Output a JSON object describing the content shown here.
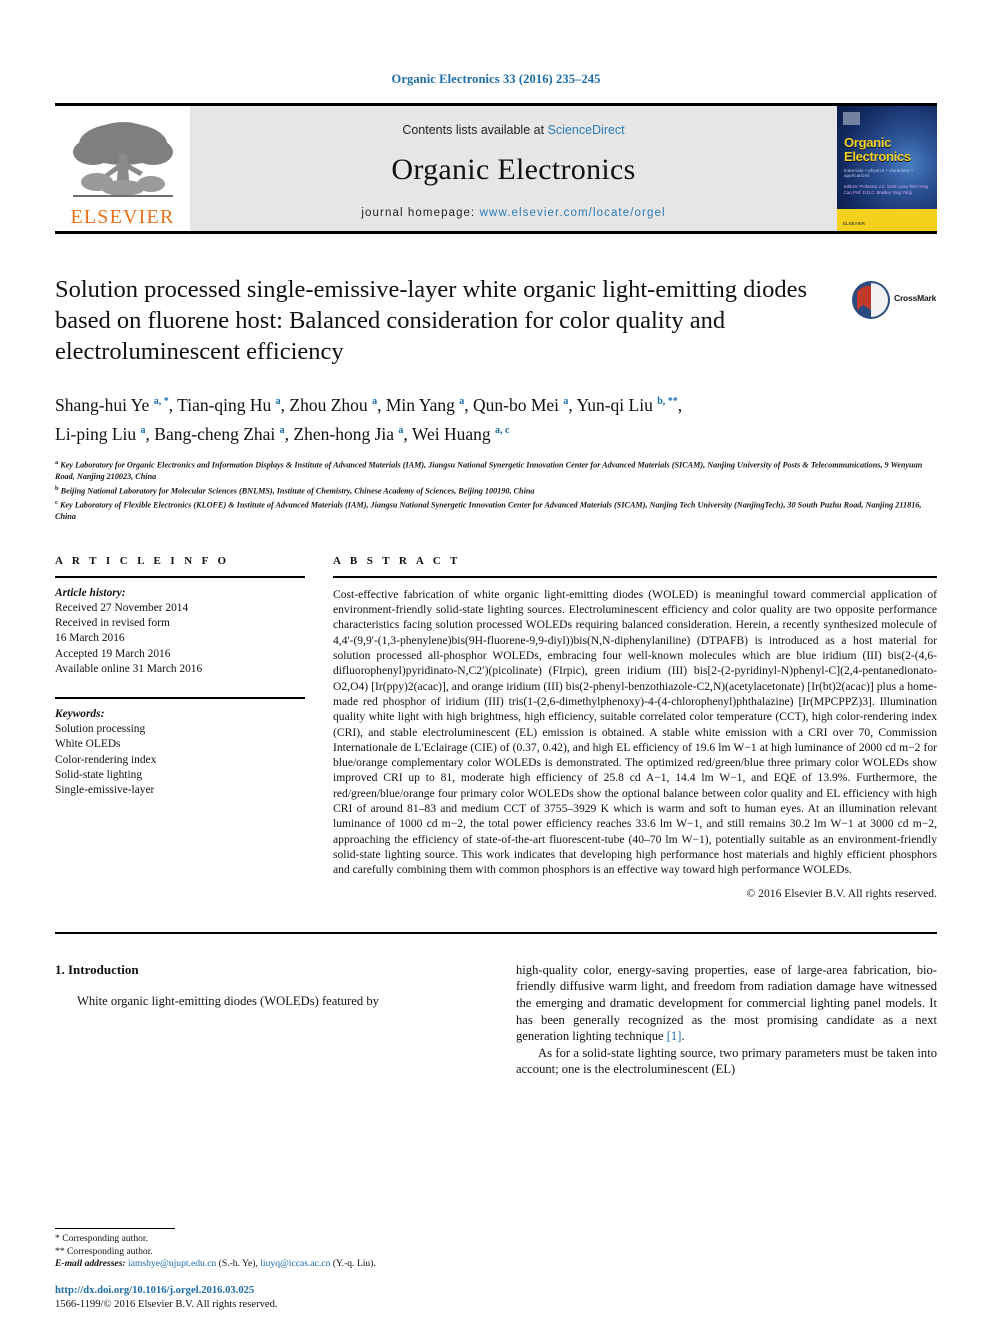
{
  "running_head": "Organic Electronics 33 (2016) 235–245",
  "masthead": {
    "publisher_name": "ELSEVIER",
    "contents_prefix": "Contents lists available at",
    "contents_link": "ScienceDirect",
    "journal_name": "Organic Electronics",
    "homepage_prefix": "journal homepage:",
    "homepage_url": "www.elsevier.com/locate/orgel",
    "cover": {
      "title_line1": "Organic",
      "title_line2": "Electronics",
      "subtitle": "materials • physics • chemistry • applications",
      "editors": "Editors:\nProfessor J.C. Scott\nLuisa Torsi\nYong Cao\nProf. D.D.C. Bradley\nYang Yang"
    }
  },
  "article": {
    "title": "Solution processed single-emissive-layer white organic light-emitting diodes based on fluorene host: Balanced consideration for color quality and electroluminescent efficiency",
    "crossmark_label": "CrossMark",
    "authors_line1": "Shang-hui Ye a, *, Tian-qing Hu a, Zhou Zhou a, Min Yang a, Qun-bo Mei a, Yun-qi Liu b, **,",
    "authors_line2": "Li-ping Liu a, Bang-cheng Zhai a, Zhen-hong Jia a, Wei Huang a, c",
    "authors": [
      {
        "name": "Shang-hui Ye",
        "marks": "a, *"
      },
      {
        "name": "Tian-qing Hu",
        "marks": "a"
      },
      {
        "name": "Zhou Zhou",
        "marks": "a"
      },
      {
        "name": "Min Yang",
        "marks": "a"
      },
      {
        "name": "Qun-bo Mei",
        "marks": "a"
      },
      {
        "name": "Yun-qi Liu",
        "marks": "b, **"
      },
      {
        "name": "Li-ping Liu",
        "marks": "a"
      },
      {
        "name": "Bang-cheng Zhai",
        "marks": "a"
      },
      {
        "name": "Zhen-hong Jia",
        "marks": "a"
      },
      {
        "name": "Wei Huang",
        "marks": "a, c"
      }
    ],
    "affiliations": [
      {
        "mark": "a",
        "text": "Key Laboratory for Organic Electronics and Information Displays & Institute of Advanced Materials (IAM), Jiangsu National Synergetic Innovation Center for Advanced Materials (SICAM), Nanjing University of Posts & Telecommunications, 9 Wenyuan Road, Nanjing 210023, China"
      },
      {
        "mark": "b",
        "text": "Beijing National Laboratory for Molecular Sciences (BNLMS), Institute of Chemistry, Chinese Academy of Sciences, Beijing 100190, China"
      },
      {
        "mark": "c",
        "text": "Key Laboratory of Flexible Electronics (KLOFE) & Institute of Advanced Materials (IAM), Jiangsu National Synergetic Innovation Center for Advanced Materials (SICAM), Nanjing Tech University (NanjingTech), 30 South Puzhu Road, Nanjing 211816, China"
      }
    ]
  },
  "article_info": {
    "heading": "A R T I C L E   I N F O",
    "history_label": "Article history:",
    "history": [
      "Received 27 November 2014",
      "Received in revised form",
      "16 March 2016",
      "Accepted 19 March 2016",
      "Available online 31 March 2016"
    ],
    "keywords_label": "Keywords:",
    "keywords": [
      "Solution processing",
      "White OLEDs",
      "Color-rendering index",
      "Solid-state lighting",
      "Single-emissive-layer"
    ]
  },
  "abstract": {
    "heading": "A B S T R A C T",
    "text": "Cost-effective fabrication of white organic light-emitting diodes (WOLED) is meaningful toward commercial application of environment-friendly solid-state lighting sources. Electroluminescent efficiency and color quality are two opposite performance characteristics facing solution processed WOLEDs requiring balanced consideration. Herein, a recently synthesized molecule of 4,4'-(9,9'-(1,3-phenylene)bis(9H-fluorene-9,9-diyl))bis(N,N-diphenylaniline) (DTPAFB) is introduced as a host material for solution processed all-phosphor WOLEDs, embracing four well-known molecules which are blue iridium (III) bis(2-(4,6-difluorophenyl)pyridinato-N,C2′)(picolinate) (FIrpic), green iridium (III) bis[2-(2-pyridinyl-N)phenyl-C](2,4-pentanedionato-O2,O4) [Ir(ppy)2(acac)], and orange iridium (III) bis(2-phenyl-benzothiazole-C2,N)(acetylacetonate) [Ir(bt)2(acac)] plus a home-made red phosphor of iridium (III) tris(1-(2,6-dimethylphenoxy)-4-(4-chlorophenyl)phthalazine) [Ir(MPCPPZ)3]. Illumination quality white light with high brightness, high efficiency, suitable correlated color temperature (CCT), high color-rendering index (CRI), and stable electroluminescent (EL) emission is obtained. A stable white emission with a CRI over 70, Commission Internationale de L'Eclairage (CIE) of (0.37, 0.42), and high EL efficiency of 19.6 lm W−1 at high luminance of 2000 cd m−2 for blue/orange complementary color WOLEDs is demonstrated. The optimized red/green/blue three primary color WOLEDs show improved CRI up to 81, moderate high efficiency of 25.8 cd A−1, 14.4 lm W−1, and EQE of 13.9%. Furthermore, the red/green/blue/orange four primary color WOLEDs show the optional balance between color quality and EL efficiency with high CRI of around 81–83 and medium CCT of 3755–3929 K which is warm and soft to human eyes. At an illumination relevant luminance of 1000 cd m−2, the total power efficiency reaches 33.6 lm W−1, and still remains 30.2 lm W−1 at 3000 cd m−2, approaching the efficiency of state-of-the-art fluorescent-tube (40–70 lm W−1), potentially suitable as an environment-friendly solid-state lighting source. This work indicates that developing high performance host materials and highly efficient phosphors and carefully combining them with common phosphors is an effective way toward high performance WOLEDs.",
    "copyright": "© 2016 Elsevier B.V. All rights reserved."
  },
  "body": {
    "section_number_title": "1.  Introduction",
    "left_paragraph": "White organic light-emitting diodes (WOLEDs) featured by",
    "right_paragraph_1_pre": "high-quality color, energy-saving properties, ease of large-area fabrication, bio-friendly diffusive warm light, and freedom from radiation damage have witnessed the emerging and dramatic development for commercial lighting panel models. It has been generally recognized as the most promising candidate as a next generation lighting technique ",
    "right_paragraph_1_ref": "[1]",
    "right_paragraph_1_post": ".",
    "right_paragraph_2": "As for a solid-state lighting source, two primary parameters must be taken into account; one is the electroluminescent (EL)"
  },
  "footnotes": {
    "corresponding_1": "* Corresponding author.",
    "corresponding_2": "** Corresponding author.",
    "email_label": "E-mail addresses:",
    "email_1": "iamshye@njupt.edu.cn",
    "email_1_owner": "(S.-h. Ye),",
    "email_2": "liuyq@iccas.ac.cn",
    "email_2_owner": "(Y.-q. Liu).",
    "doi": "http://dx.doi.org/10.1016/j.orgel.2016.03.025",
    "issn": "1566-1199/© 2016 Elsevier B.V. All rights reserved."
  },
  "colors": {
    "link_blue": "#1b6ca8",
    "elsevier_orange": "#E9711C",
    "band_gray": "#e6e6e6",
    "cover_yellow": "#f3d11c"
  }
}
